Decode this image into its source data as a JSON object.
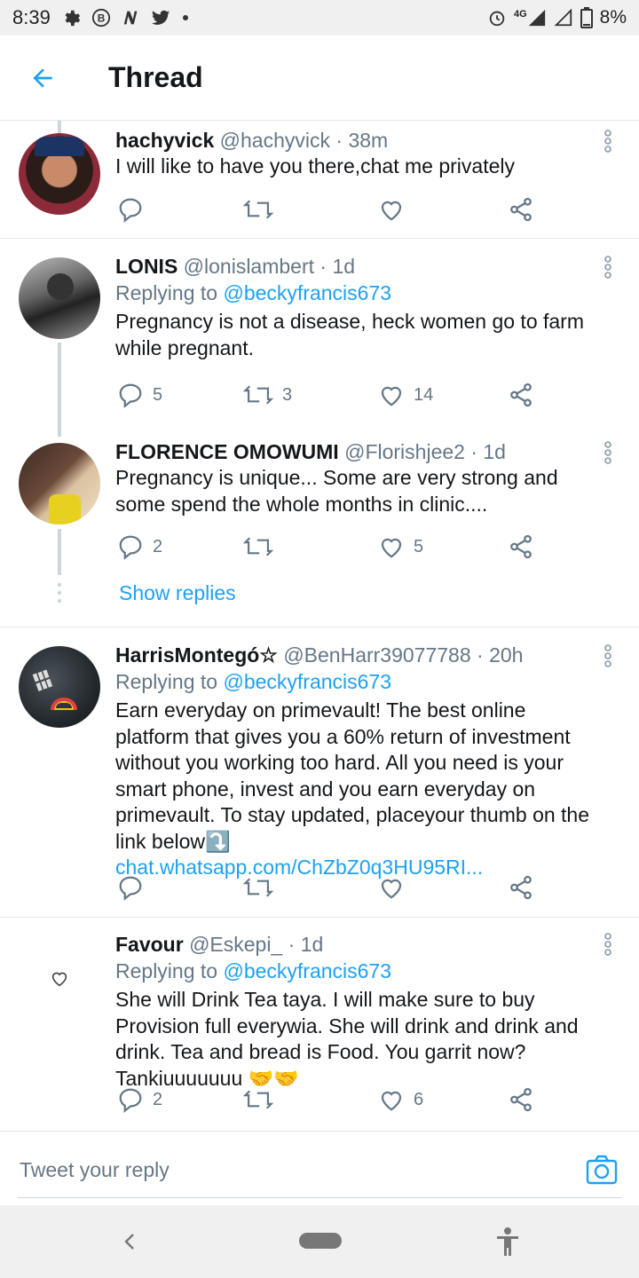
{
  "status_bar": {
    "time": "8:39",
    "network": "4G",
    "battery": "8%",
    "icons": [
      "gear-icon",
      "b-circle-icon",
      "n-icon",
      "twitter-bird-icon",
      "dot-icon",
      "alarm-icon",
      "signal-icon",
      "signal-empty-icon",
      "battery-icon"
    ]
  },
  "header": {
    "title": "Thread",
    "back_icon": "arrow-left-icon"
  },
  "tweets": [
    {
      "name": "hachyvick",
      "handle": "@hachyvick",
      "time": "38m",
      "text": "I will like to have you there,chat me privately",
      "replies": "",
      "retweets": "",
      "likes": ""
    },
    {
      "name": "LONIS",
      "handle": "@lonislambert",
      "time": "1d",
      "replying_prefix": "Replying to ",
      "replying_to": "@beckyfrancis673",
      "text": "Pregnancy is not a disease, heck women go to farm while pregnant.",
      "replies": "5",
      "retweets": "3",
      "likes": "14"
    },
    {
      "name": "FLORENCE OMOWUMI",
      "handle": "@Florishjee2",
      "time": "1d",
      "text": "Pregnancy is unique... Some are very strong and some spend the whole months in clinic....",
      "replies": "2",
      "retweets": "",
      "likes": "5"
    },
    {
      "name": "HarrisMontegó☆",
      "handle": "@BenHarr39077788",
      "time": "20h",
      "replying_prefix": "Replying to ",
      "replying_to": "@beckyfrancis673",
      "text": "Earn everyday on primevault! The best online platform that gives you a 60% return of investment without you working too hard. All you need is your smart phone, invest and you earn everyday on primevault. To stay updated, placeyour thumb on the link below⤵️",
      "link": "chat.whatsapp.com/ChZbZ0q3HU95RI...",
      "replies": "",
      "retweets": "",
      "likes": ""
    },
    {
      "name": "Favour",
      "handle": "@Eskepi_",
      "time": "1d",
      "replying_prefix": "Replying to ",
      "replying_to": "@beckyfrancis673",
      "text": "She will Drink Tea taya. I will make sure to buy Provision full everywia. She will drink and drink and drink. Tea and bread is Food. You garrit now? Tankiuuuuuuu 🤝🤝",
      "replies": "2",
      "retweets": "",
      "likes": "6"
    }
  ],
  "separator": " · ",
  "show_replies": "Show replies",
  "composer": {
    "placeholder": "Tweet your reply",
    "camera_icon": "camera-icon"
  },
  "colors": {
    "accent": "#1da1f2",
    "secondary_text": "#657786",
    "divider": "#e1e8ed"
  }
}
